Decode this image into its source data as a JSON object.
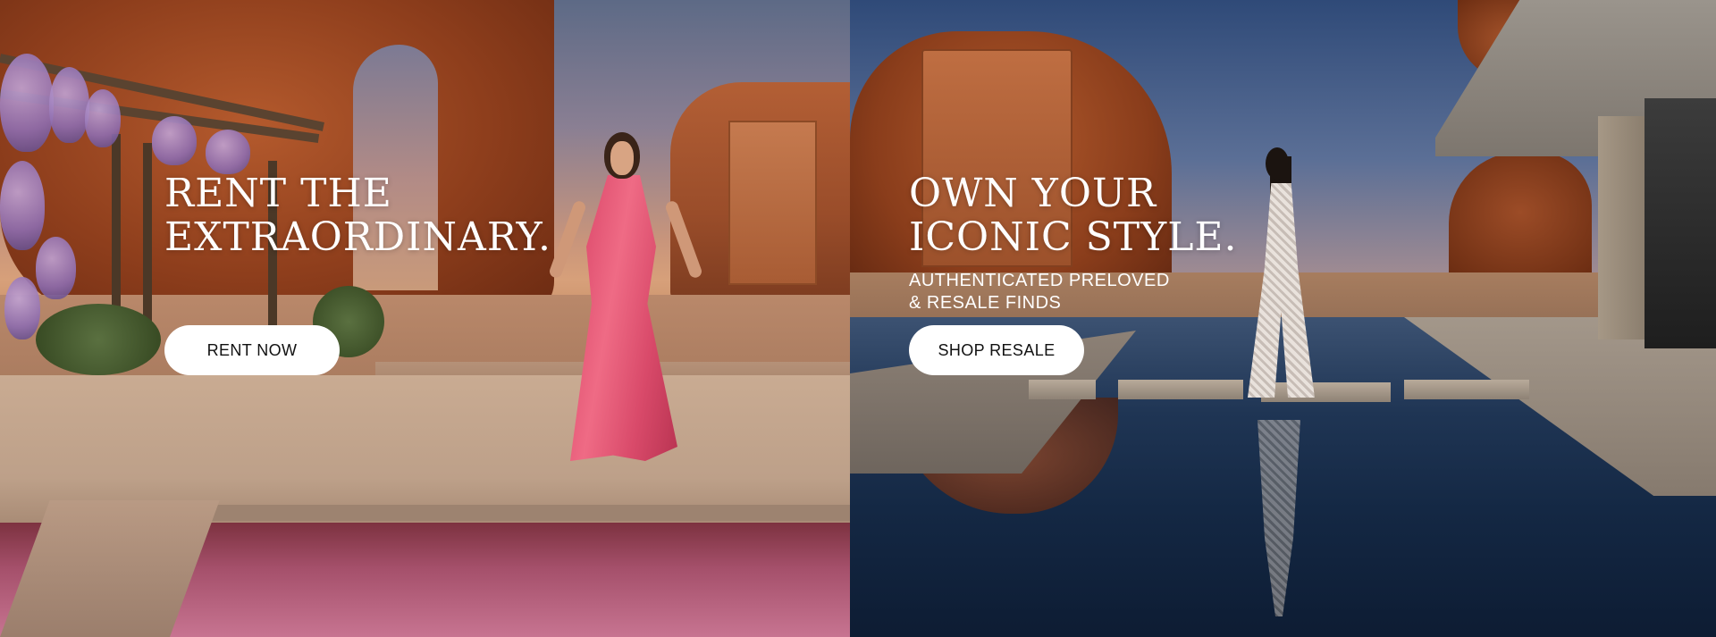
{
  "panels": {
    "rent": {
      "headline_line1": "RENT THE",
      "headline_line2": "EXTRAORDINARY.",
      "cta_label": "RENT NOW"
    },
    "resale": {
      "headline_line1": "OWN YOUR",
      "headline_line2": "ICONIC STYLE.",
      "subline_line1": "AUTHENTICATED PRELOVED",
      "subline_line2": "& RESALE FINDS",
      "cta_label": "SHOP RESALE"
    }
  },
  "colors": {
    "text": "#ffffff",
    "button_bg": "#ffffff",
    "button_text": "#111111",
    "left_accent_pink": "#ef6b85",
    "right_pool_blue": "#1f3554"
  }
}
